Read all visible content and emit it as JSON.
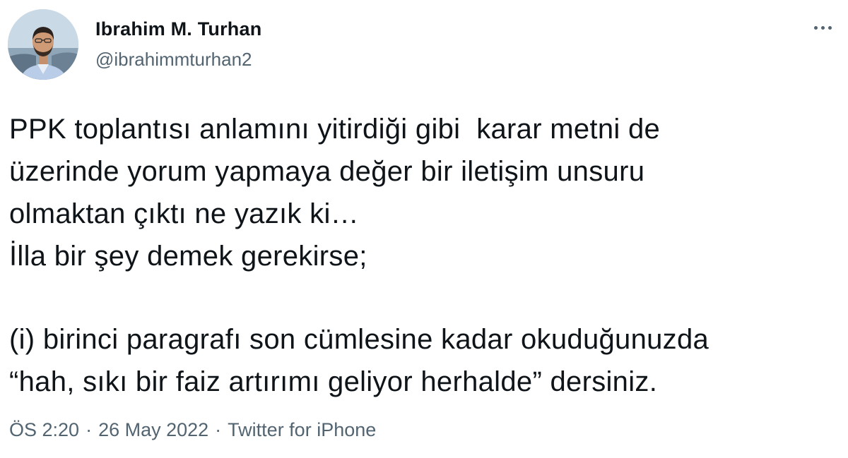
{
  "author": {
    "display_name": "Ibrahim M. Turhan",
    "handle": "@ibrahimmturhan2",
    "avatar_icon": "profile-photo"
  },
  "more_icon": "more-horizontal-icon",
  "tweet": {
    "lines": [
      "PPK toplantısı anlamını yitirdiği gibi  karar metni de",
      "üzerinde yorum yapmaya değer bir iletişim unsuru",
      "olmaktan çıktı ne yazık ki…",
      "İlla bir şey demek gerekirse;",
      "",
      "(i) birinci paragrafı son cümlesine kadar okuduğunuzda",
      "“hah, sıkı bir faiz artırımı geliyor herhalde” dersiniz."
    ]
  },
  "meta": {
    "time": "ÖS 2:20",
    "separator": "·",
    "date": "26 May 2022",
    "source": "Twitter for iPhone"
  },
  "colors": {
    "text_primary": "#0f1419",
    "text_secondary": "#536471",
    "background": "#ffffff"
  }
}
